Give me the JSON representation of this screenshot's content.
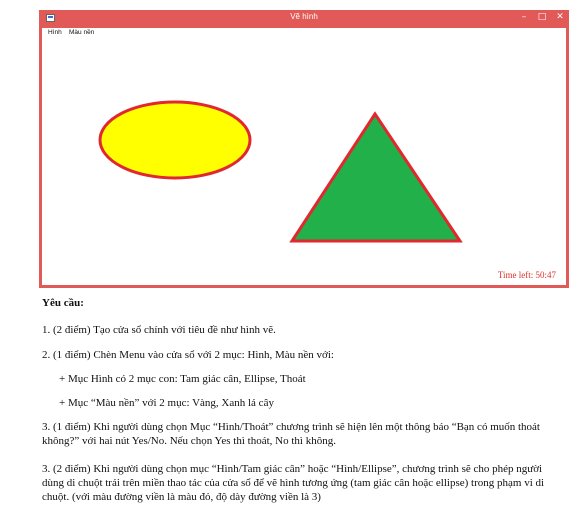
{
  "window": {
    "title": "Vẽ hình",
    "controls": {
      "minimize": "–",
      "maximize": "□",
      "close": "✕"
    },
    "menu": [
      "Hình",
      "Màu nền"
    ],
    "canvas": {
      "shapes": [
        {
          "type": "ellipse",
          "fill": "#ffff00",
          "stroke": "#e0282e"
        },
        {
          "type": "triangle",
          "fill": "#22b04b",
          "stroke": "#e0282e"
        }
      ]
    },
    "time_left": "Time left: 50:47",
    "accent_color": "#e25a57"
  },
  "document": {
    "heading": "Yêu cầu:",
    "item1": "1. (2 điểm) Tạo cửa sổ chính với tiêu đề như hình vẽ.",
    "item2": "2. (1 điểm) Chèn Menu vào cửa sổ với 2 mục: Hình, Màu nền với:",
    "sub1": "+ Mục Hình có 2 mục con: Tam giác cân, Ellipse, Thoát",
    "sub2": "+ Mục “Màu nền”  với 2 mục: Vàng, Xanh lá cây",
    "item3": "3. (1 điểm) Khi người dùng chọn Mục “Hình/Thoát” chương trình sẽ hiện lên một thông báo “Bạn có muốn thoát không?” với hai nút Yes/No. Nếu chọn Yes thì thoát, No thì không.",
    "item4": "3. (2 điểm) Khi người dùng chọn mục “Hình/Tam giác cân” hoặc “Hình/Ellipse”, chương trình sẽ cho phép người dùng di chuột trái trên miền thao tác của cửa sổ để vẽ hình tương ứng (tam giác cân hoặc ellipse) trong phạm vi di chuột. (với màu đường viền là màu đỏ, độ dày đường viền là 3)"
  }
}
